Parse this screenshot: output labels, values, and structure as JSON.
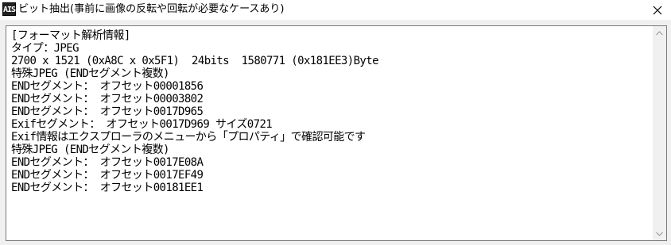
{
  "window": {
    "icon_text": "AIS",
    "title": "ビット抽出(事前に画像の反転や回転が必要なケースあり)"
  },
  "output": {
    "lines": [
      "[フォーマット解析情報]",
      "タイプ：JPEG",
      "2700 x 1521 (0xA8C x 0x5F1)  24bits  1580771 (0x181EE3)Byte",
      "特殊JPEG (ENDセグメント複数)",
      "ENDセグメント： オフセット00001856",
      "ENDセグメント： オフセット00003802",
      "ENDセグメント： オフセット0017D965",
      "Exifセグメント： オフセット0017D969 サイズ0721",
      "Exif情報はエクスプローラのメニューから「プロパティ」で確認可能です",
      "特殊JPEG (ENDセグメント複数)",
      "ENDセグメント： オフセット0017E08A",
      "ENDセグメント： オフセット0017EF49",
      "ENDセグメント： オフセット00181EE1"
    ]
  },
  "icons": {
    "close": "close-icon",
    "scroll_up": "chevron-up-icon",
    "scroll_down": "chevron-down-icon"
  }
}
